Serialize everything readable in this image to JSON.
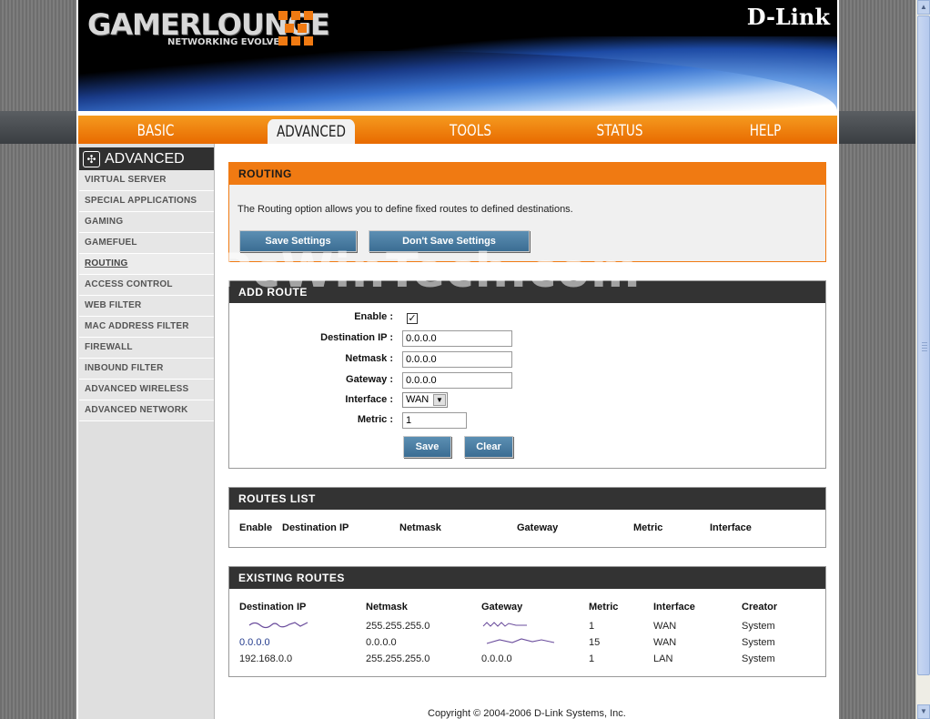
{
  "header": {
    "logo_text": "GAMERLOUNGE",
    "logo_tagline": "NETWORKING EVOLVED",
    "brand": "D-Link"
  },
  "nav": {
    "tabs": [
      {
        "label": "BASIC",
        "active": false
      },
      {
        "label": "ADVANCED",
        "active": true
      },
      {
        "label": "TOOLS",
        "active": false
      },
      {
        "label": "STATUS",
        "active": false
      },
      {
        "label": "HELP",
        "active": false
      }
    ]
  },
  "sidebar": {
    "title": "ADVANCED",
    "items": [
      {
        "label": "VIRTUAL SERVER",
        "active": false
      },
      {
        "label": "SPECIAL APPLICATIONS",
        "active": false
      },
      {
        "label": "GAMING",
        "active": false
      },
      {
        "label": "GAMEFUEL",
        "active": false
      },
      {
        "label": "ROUTING",
        "active": true
      },
      {
        "label": "ACCESS CONTROL",
        "active": false
      },
      {
        "label": "WEB FILTER",
        "active": false
      },
      {
        "label": "MAC ADDRESS FILTER",
        "active": false
      },
      {
        "label": "FIREWALL",
        "active": false
      },
      {
        "label": "INBOUND FILTER",
        "active": false
      },
      {
        "label": "ADVANCED WIRELESS",
        "active": false
      },
      {
        "label": "ADVANCED NETWORK",
        "active": false
      }
    ]
  },
  "routing": {
    "title": "ROUTING",
    "description": "The Routing option allows you to define fixed routes to defined destinations.",
    "save_label": "Save Settings",
    "dont_save_label": "Don't Save Settings"
  },
  "add_route": {
    "title": "ADD ROUTE",
    "enable_label": "Enable :",
    "enable_checked": true,
    "dest_ip_label": "Destination IP :",
    "dest_ip_value": "0.0.0.0",
    "netmask_label": "Netmask :",
    "netmask_value": "0.0.0.0",
    "gateway_label": "Gateway :",
    "gateway_value": "0.0.0.0",
    "interface_label": "Interface :",
    "interface_value": "WAN",
    "metric_label": "Metric :",
    "metric_value": "1",
    "save_label": "Save",
    "clear_label": "Clear"
  },
  "routes_list": {
    "title": "ROUTES LIST",
    "columns": [
      "Enable",
      "Destination IP",
      "Netmask",
      "Gateway",
      "Metric",
      "Interface"
    ]
  },
  "existing_routes": {
    "title": "EXISTING ROUTES",
    "columns": [
      "Destination IP",
      "Netmask",
      "Gateway",
      "Metric",
      "Interface",
      "Creator"
    ],
    "rows": [
      {
        "dest": "",
        "netmask": "255.255.255.0",
        "gateway": "",
        "metric": "1",
        "interface": "WAN",
        "creator": "System"
      },
      {
        "dest": "0.0.0.0",
        "netmask": "0.0.0.0",
        "gateway": "",
        "metric": "15",
        "interface": "WAN",
        "creator": "System"
      },
      {
        "dest": "192.168.0.0",
        "netmask": "255.255.255.0",
        "gateway": "0.0.0.0",
        "metric": "1",
        "interface": "LAN",
        "creator": "System"
      }
    ]
  },
  "footer": {
    "copyright": "Copyright © 2004-2006 D-Link Systems, Inc."
  },
  "watermark": "PcWinTech.com",
  "colors": {
    "accent_orange": "#f07a12",
    "button_blue": "#4a7ea5",
    "section_header": "#333333"
  }
}
